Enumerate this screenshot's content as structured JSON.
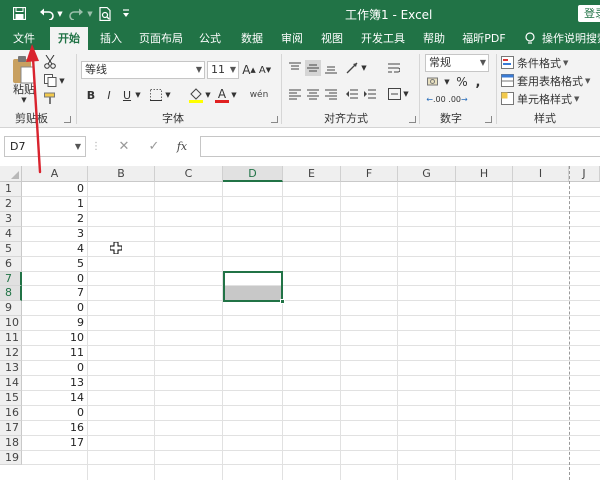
{
  "titlebar": {
    "title": "工作簿1  -  Excel",
    "signin": "登录"
  },
  "tabs": [
    "文件",
    "开始",
    "插入",
    "页面布局",
    "公式",
    "数据",
    "审阅",
    "视图",
    "开发工具",
    "帮助",
    "福昕PDF",
    "操作说明搜索"
  ],
  "active_tab": "开始",
  "ribbon": {
    "clipboard": {
      "paste_label": "粘贴",
      "group_label": "剪贴板"
    },
    "font": {
      "font_name": "等线",
      "font_size": "11",
      "bold": "B",
      "italic": "I",
      "underline": "U",
      "grow": "A",
      "shrink": "A",
      "font_color": "A",
      "phonetic": "wén",
      "group_label": "字体"
    },
    "alignment": {
      "group_label": "对齐方式"
    },
    "number": {
      "format": "常规",
      "percent": "%",
      "comma": ",",
      "increase_decimal": ".00",
      "decrease_decimal": ".00",
      "group_label": "数字"
    },
    "styles": {
      "conditional": "条件格式",
      "table": "套用表格格式",
      "cell": "单元格样式",
      "group_label": "样式"
    }
  },
  "formula_bar": {
    "name_box": "D7",
    "fx": "fx",
    "value": ""
  },
  "columns": [
    "A",
    "B",
    "C",
    "D",
    "E",
    "F",
    "G",
    "H",
    "I",
    "J"
  ],
  "selected_column": "D",
  "rows": [
    "1",
    "2",
    "3",
    "4",
    "5",
    "6",
    "7",
    "8",
    "9",
    "10",
    "11",
    "12",
    "13",
    "14",
    "15",
    "16",
    "17",
    "18",
    "19"
  ],
  "selected_rows": [
    "7",
    "8"
  ],
  "column_a_values": [
    "0",
    "1",
    "2",
    "3",
    "4",
    "5",
    "0",
    "7",
    "0",
    "9",
    "10",
    "11",
    "0",
    "13",
    "14",
    "0",
    "16",
    "17",
    ""
  ],
  "colors": {
    "accent": "#217346",
    "arrow": "#d9232e"
  }
}
